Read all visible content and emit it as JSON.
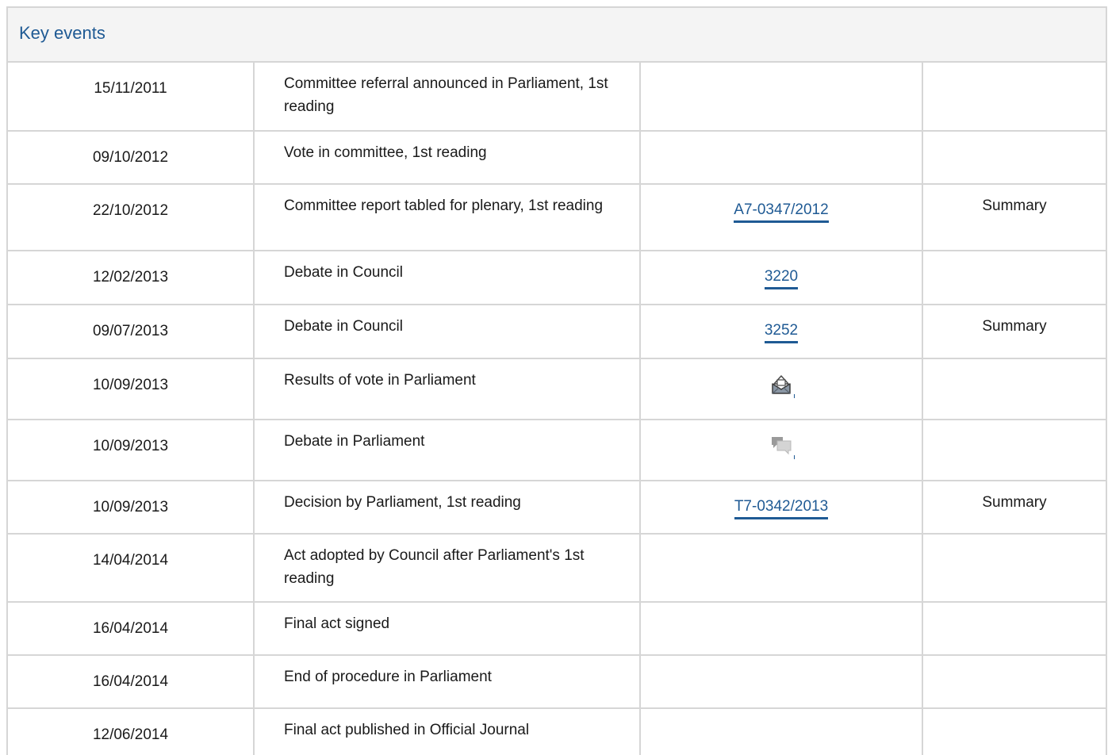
{
  "panel": {
    "title": "Key events"
  },
  "events": [
    {
      "date": "15/11/2011",
      "event": "Committee referral announced in Parliament, 1st reading",
      "ref": "",
      "ref_type": "none",
      "summary": ""
    },
    {
      "date": "09/10/2012",
      "event": "Vote in committee, 1st reading",
      "ref": "",
      "ref_type": "none",
      "summary": ""
    },
    {
      "date": "22/10/2012",
      "event": "Committee report tabled for plenary, 1st reading",
      "ref": "A7-0347/2012",
      "ref_type": "link",
      "summary": "Summary"
    },
    {
      "date": "12/02/2013",
      "event": "Debate in Council",
      "ref": "3220",
      "ref_type": "link",
      "summary": ""
    },
    {
      "date": "09/07/2013",
      "event": "Debate in Council",
      "ref": "3252",
      "ref_type": "link",
      "summary": "Summary"
    },
    {
      "date": "10/09/2013",
      "event": "Results of vote in Parliament",
      "ref": "",
      "ref_type": "vote-icon",
      "summary": ""
    },
    {
      "date": "10/09/2013",
      "event": "Debate in Parliament",
      "ref": "",
      "ref_type": "debate-icon",
      "summary": ""
    },
    {
      "date": "10/09/2013",
      "event": "Decision by Parliament, 1st reading",
      "ref": "T7-0342/2013",
      "ref_type": "link",
      "summary": "Summary"
    },
    {
      "date": "14/04/2014",
      "event": "Act adopted by Council after Parliament's 1st reading",
      "ref": "",
      "ref_type": "none",
      "summary": ""
    },
    {
      "date": "16/04/2014",
      "event": "Final act signed",
      "ref": "",
      "ref_type": "none",
      "summary": ""
    },
    {
      "date": "16/04/2014",
      "event": "End of procedure in Parliament",
      "ref": "",
      "ref_type": "none",
      "summary": ""
    },
    {
      "date": "12/06/2014",
      "event": "Final act published in Official Journal",
      "ref": "",
      "ref_type": "none",
      "summary": ""
    }
  ],
  "colors": {
    "link": "#1f5a94",
    "border": "#d6d6d6",
    "header_bg": "#f4f4f4"
  }
}
